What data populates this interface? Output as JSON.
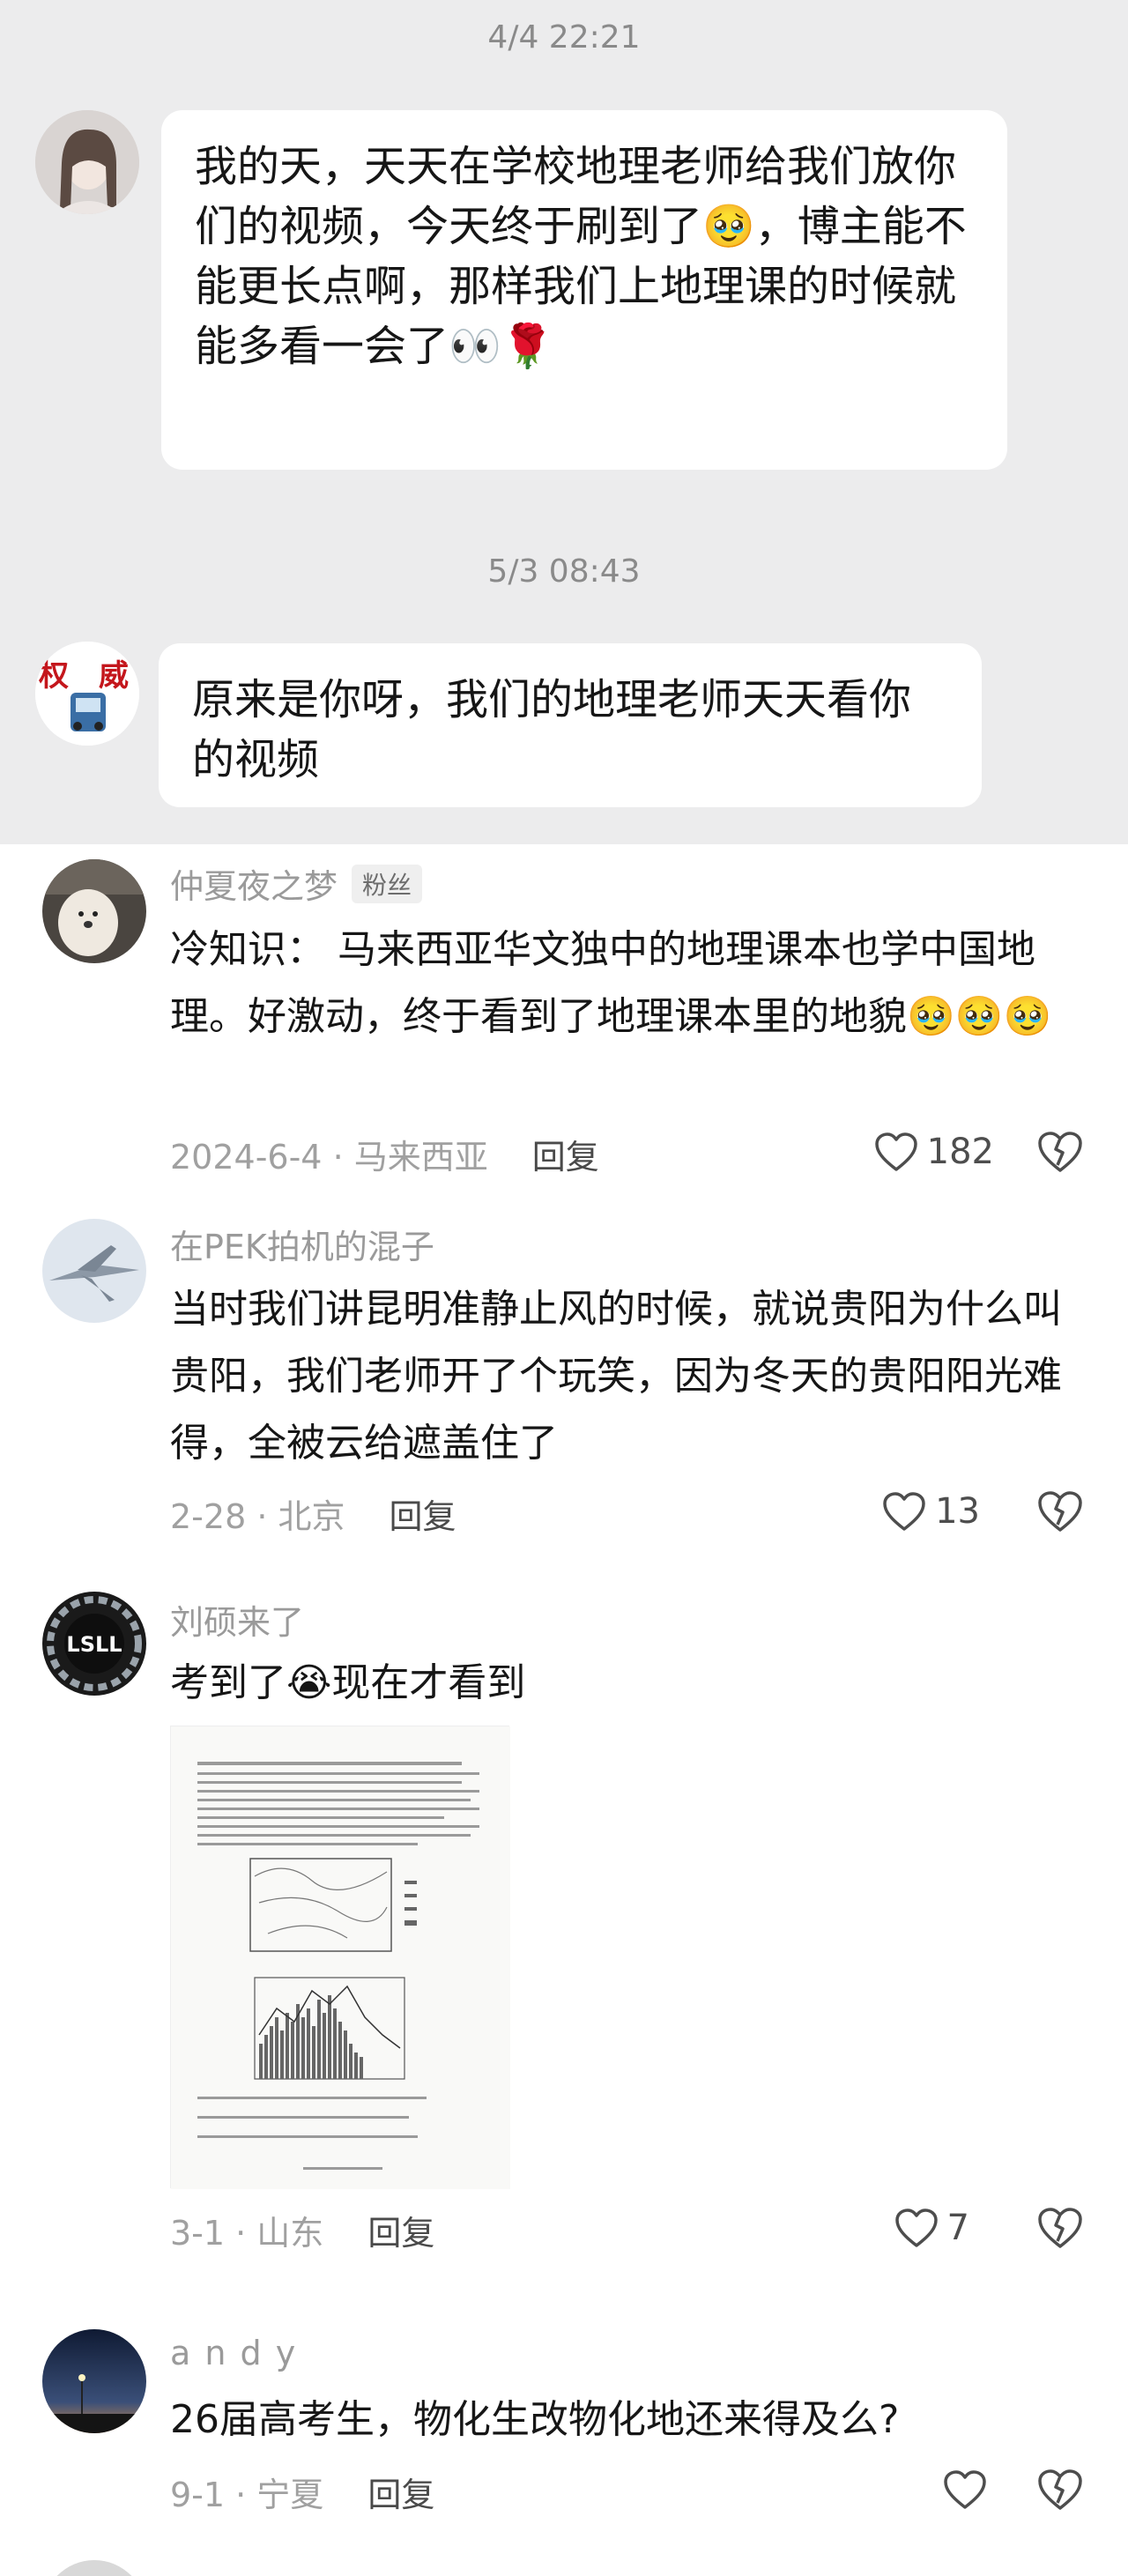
{
  "chat": {
    "messages": [
      {
        "time": "4/4 22:21",
        "text": "我的天，天天在学校地理老师给我们放你们的视频，今天终于刷到了🥹，博主能不能更长点啊，那样我们上地理课的时候就能多看一会了👀🌹"
      },
      {
        "time": "5/3 08:43",
        "text": "原来是你呀，我们的地理老师天天看你的视频"
      }
    ]
  },
  "comments": [
    {
      "name": "仲夏夜之梦",
      "badge": "粉丝",
      "text": "冷知识： 马来西亚华文独中的地理课本也学中国地理。好激动，终于看到了地理课本里的地貌🥹🥹🥹",
      "meta": "2024-6-4 · 马来西亚",
      "reply": "回复",
      "likes": "182"
    },
    {
      "name": "在PEK拍机的混子",
      "text": "当时我们讲昆明准静止风的时候，就说贵阳为什么叫贵阳，我们老师开了个玩笑，因为冬天的贵阳阳光难得，全被云给遮盖住了",
      "meta": "2-28 · 北京",
      "reply": "回复",
      "likes": "13"
    },
    {
      "name": "刘硕来了",
      "text": "考到了😭现在才看到",
      "meta": "3-1 · 山东",
      "reply": "回复",
      "likes": "7",
      "avatar_text": "LSLL"
    },
    {
      "name": "a n d y",
      "text": "26届高考生，物化生改物化地还来得及么?",
      "meta": "9-1 · 宁夏",
      "reply": "回复",
      "likes": ""
    }
  ],
  "colors": {
    "chat_bg": "#ececed",
    "bubble": "#ffffff",
    "meta": "#a0a0a0",
    "name": "#9a9a9a"
  }
}
